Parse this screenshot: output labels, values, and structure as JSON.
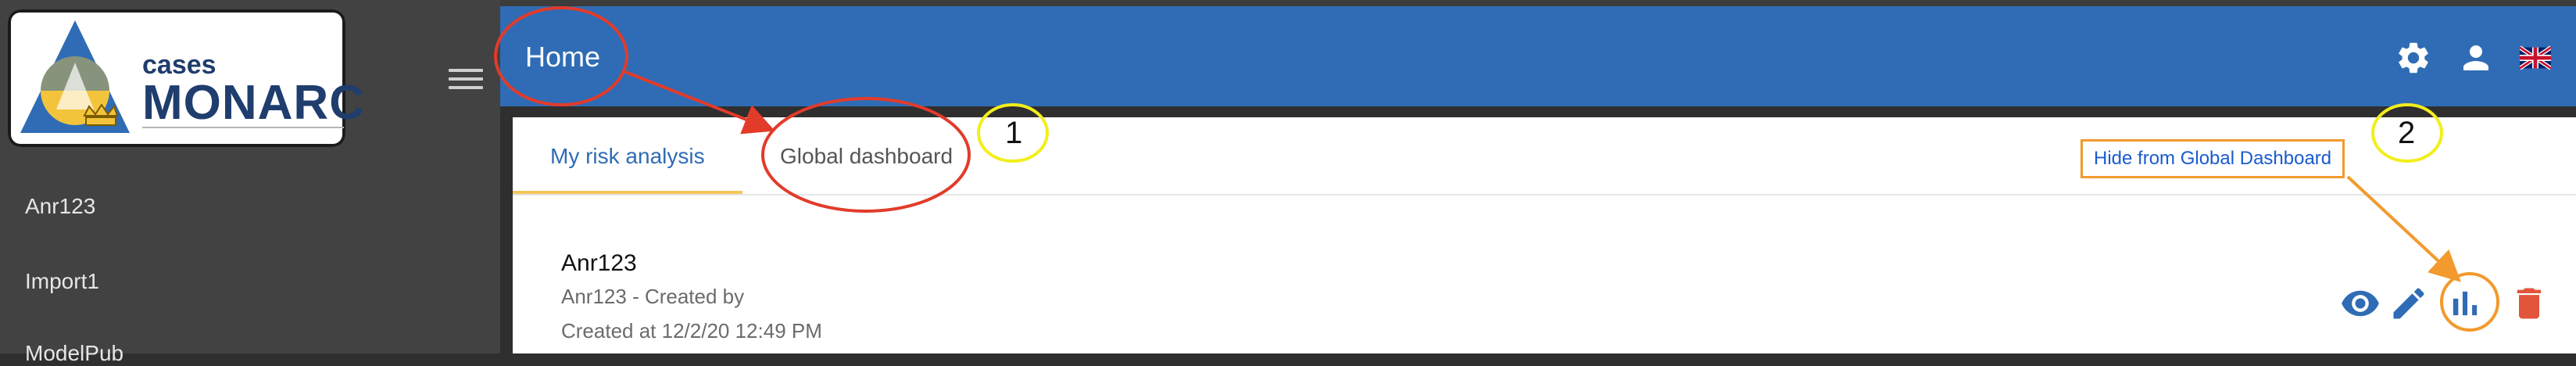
{
  "app": {
    "logo_small": "cases",
    "logo_big": "MONARC"
  },
  "sidebar": {
    "items": [
      {
        "label": "Anr123"
      },
      {
        "label": "Import1"
      },
      {
        "label": "ModelPub"
      }
    ]
  },
  "header": {
    "title": "Home",
    "icons": [
      "gear-icon",
      "person-icon",
      "uk-flag-icon"
    ],
    "color": "#2f6cb5"
  },
  "tabs": [
    {
      "label": "My risk analysis",
      "active": true
    },
    {
      "label": "Global dashboard",
      "active": false
    }
  ],
  "tooltip": {
    "label": "Hide from Global Dashboard"
  },
  "risk_analysis": {
    "name": "Anr123",
    "subtitle": "Anr123 - Created by",
    "created": "Created at 12/2/20 12:49 PM",
    "actions": [
      "eye-icon",
      "edit-icon",
      "bar-chart-icon",
      "delete-icon"
    ]
  },
  "annotations": {
    "one": "1",
    "two": "2",
    "colors": {
      "red": "#e23b2a",
      "yellow": "#f2ee1c",
      "orange": "#f29a2e"
    }
  }
}
